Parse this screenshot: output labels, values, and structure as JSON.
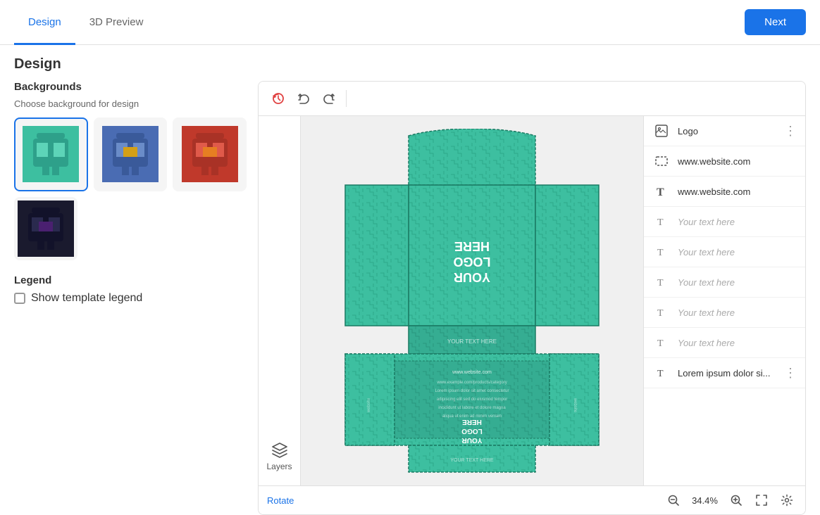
{
  "header": {
    "tab_design": "Design",
    "tab_3d": "3D Preview",
    "btn_next": "Next"
  },
  "page": {
    "title": "Design"
  },
  "backgrounds": {
    "title": "Backgrounds",
    "subtitle": "Choose background for design",
    "items": [
      {
        "id": "bg1",
        "selected": true,
        "color": "#3dbfa0",
        "pattern": "teal"
      },
      {
        "id": "bg2",
        "selected": false,
        "color": "#4a6cb3",
        "pattern": "blue"
      },
      {
        "id": "bg3",
        "selected": false,
        "color": "#c0392b",
        "pattern": "red"
      },
      {
        "id": "bg4",
        "selected": false,
        "color": "#1a1a2e",
        "pattern": "dark"
      }
    ]
  },
  "legend": {
    "title": "Legend",
    "checkbox_label": "Show template legend"
  },
  "toolbar": {
    "undo_label": "undo",
    "redo_label": "redo",
    "history_label": "history"
  },
  "canvas": {
    "zoom_level": "34.4%",
    "rotate_label": "Rotate"
  },
  "layers_btn": {
    "label": "Layers"
  },
  "right_panel": {
    "items": [
      {
        "id": "logo",
        "type": "image",
        "label": "Logo",
        "has_more": true,
        "is_placeholder": false
      },
      {
        "id": "website1",
        "type": "dashed",
        "label": "www.website.com",
        "has_more": false,
        "is_placeholder": false
      },
      {
        "id": "website2",
        "type": "T-large",
        "label": "www.website.com",
        "has_more": false,
        "is_placeholder": false
      },
      {
        "id": "text1",
        "type": "T",
        "label": "Your text here",
        "has_more": false,
        "is_placeholder": true
      },
      {
        "id": "text2",
        "type": "T",
        "label": "Your text here",
        "has_more": false,
        "is_placeholder": true
      },
      {
        "id": "text3",
        "type": "T",
        "label": "Your text here",
        "has_more": false,
        "is_placeholder": true
      },
      {
        "id": "text4",
        "type": "T",
        "label": "Your text here",
        "has_more": false,
        "is_placeholder": true
      },
      {
        "id": "text5",
        "type": "T",
        "label": "Your text here",
        "has_more": false,
        "is_placeholder": true
      },
      {
        "id": "lorem",
        "type": "T",
        "label": "Lorem ipsum dolor si...",
        "has_more": true,
        "is_placeholder": false
      }
    ]
  }
}
